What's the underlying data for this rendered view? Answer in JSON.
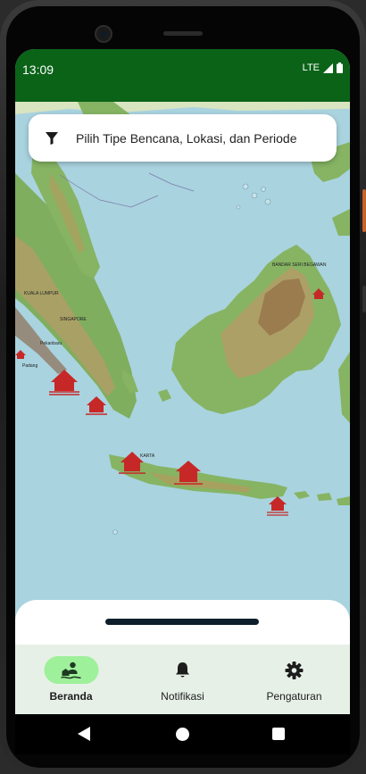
{
  "status_bar": {
    "time": "13:09",
    "network": "LTE"
  },
  "search": {
    "placeholder": "Pilih Tipe Bencana, Lokasi, dan Periode",
    "icon": "filter-icon"
  },
  "map": {
    "labels": {
      "kuala_lumpur": "KUALA LUMPUR",
      "singapore": "SINGAPORE",
      "bandar": "BANDAR SERI BEGAWAN",
      "jakarta": "KARTA",
      "pekanbaru": "Pekanbaru",
      "padang": "Padang"
    },
    "marker_color": "#c62828"
  },
  "bottom_nav": {
    "items": [
      {
        "label": "Beranda",
        "icon": "disaster-home-icon",
        "active": true
      },
      {
        "label": "Notifikasi",
        "icon": "bell-icon",
        "active": false
      },
      {
        "label": "Pengaturan",
        "icon": "gear-icon",
        "active": false
      }
    ]
  },
  "colors": {
    "status_bar": "#0b6318",
    "nav_active": "#9ef09a",
    "nav_bg": "#e7f0e7",
    "sea": "#a9d3df"
  }
}
